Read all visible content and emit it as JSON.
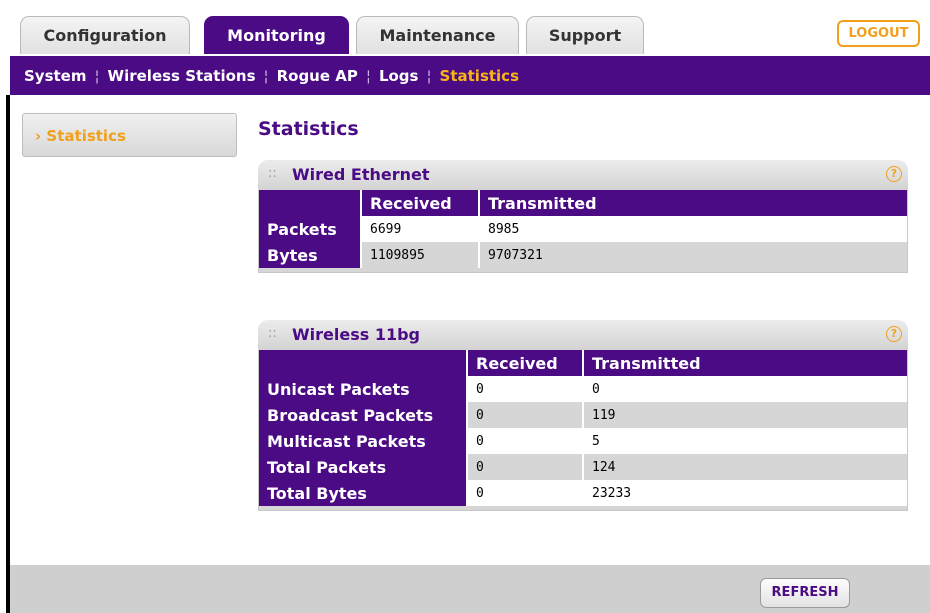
{
  "tabs": [
    {
      "label": "Configuration",
      "active": false
    },
    {
      "label": "Monitoring",
      "active": true
    },
    {
      "label": "Maintenance",
      "active": false
    },
    {
      "label": "Support",
      "active": false
    }
  ],
  "logout_label": "LOGOUT",
  "subnav": {
    "items": [
      "System",
      "Wireless Stations",
      "Rogue AP",
      "Logs",
      "Statistics"
    ],
    "active": "Statistics",
    "separator": "¦"
  },
  "sidebar": {
    "items": [
      {
        "label": "Statistics",
        "bullet": "›",
        "active": true
      }
    ]
  },
  "page_title": "Statistics",
  "wired": {
    "title": "Wired Ethernet",
    "dots": "::",
    "help": "?",
    "headers": [
      "",
      "Received",
      "Transmitted"
    ],
    "rows": [
      {
        "label": "Packets",
        "received": "6699",
        "transmitted": "8985"
      },
      {
        "label": "Bytes",
        "received": "1109895",
        "transmitted": "9707321"
      }
    ]
  },
  "wireless": {
    "title": "Wireless 11bg",
    "dots": "::",
    "help": "?",
    "headers": [
      "",
      "Received",
      "Transmitted"
    ],
    "rows": [
      {
        "label": "Unicast Packets",
        "received": "0",
        "transmitted": "0"
      },
      {
        "label": "Broadcast Packets",
        "received": "0",
        "transmitted": "119"
      },
      {
        "label": "Multicast Packets",
        "received": "0",
        "transmitted": "5"
      },
      {
        "label": "Total Packets",
        "received": "0",
        "transmitted": "124"
      },
      {
        "label": "Total Bytes",
        "received": "0",
        "transmitted": "23233"
      }
    ]
  },
  "refresh_label": "REFRESH",
  "colors": {
    "brand_purple": "#4b0b84",
    "accent_orange": "#f0a01a",
    "active_link": "#f8b51a"
  }
}
